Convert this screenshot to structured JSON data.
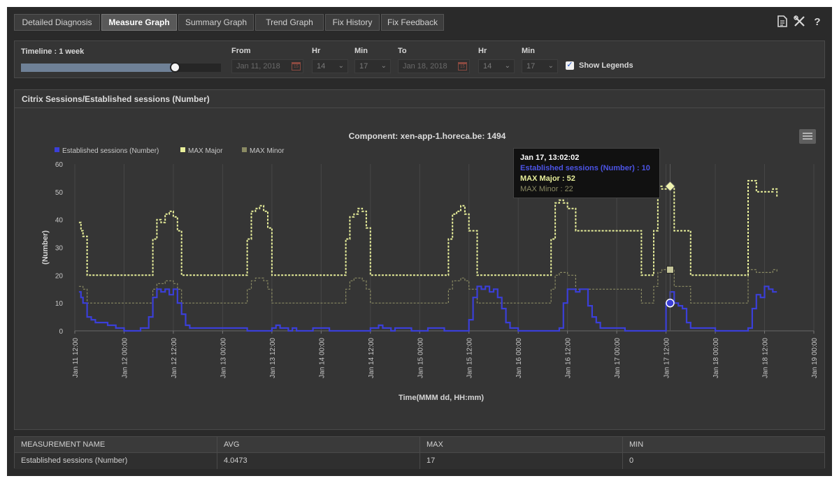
{
  "tabs": [
    {
      "label": "Detailed Diagnosis",
      "active": false
    },
    {
      "label": "Measure Graph",
      "active": true
    },
    {
      "label": "Summary Graph",
      "active": false
    },
    {
      "label": "Trend Graph",
      "active": false
    },
    {
      "label": "Fix History",
      "active": false
    },
    {
      "label": "Fix Feedback",
      "active": false
    }
  ],
  "toolbar_icons": [
    "document-icon",
    "tools-icon",
    "help-icon"
  ],
  "timeline": {
    "label": "Timeline : 1 week",
    "slider_value_fraction": 0.77,
    "from_label": "From",
    "from_date": "Jan 11, 2018",
    "from_hr_label": "Hr",
    "from_hr": "14",
    "from_min_label": "Min",
    "from_min": "17",
    "to_label": "To",
    "to_date": "Jan 18, 2018",
    "to_hr_label": "Hr",
    "to_hr": "14",
    "to_min_label": "Min",
    "to_min": "17",
    "show_legends_label": "Show Legends",
    "show_legends_checked": true
  },
  "panel_title": "Citrix Sessions/Established sessions (Number)",
  "colors": {
    "sessions": "#3b3fd8",
    "max_major": "#e8ef9a",
    "max_minor": "#8a8a63",
    "background": "#353535"
  },
  "tooltip": {
    "title": "Jan 17, 13:02:02",
    "line1": "Established sessions (Number) : 10",
    "line2": "MAX Major : 52",
    "line3": "MAX Minor : 22"
  },
  "chart_data": {
    "type": "line",
    "title": "Component: xen-app-1.horeca.be: 1494",
    "xlabel": "Time(MMM dd, HH:mm)",
    "ylabel": "(Number)",
    "ylim": [
      0,
      60
    ],
    "yticks": [
      "0",
      "10",
      "20",
      "30",
      "40",
      "50",
      "60"
    ],
    "xticks": [
      "Jan 11 12:00",
      "Jan 12 00:00",
      "Jan 12 12:00",
      "Jan 13 00:00",
      "Jan 13 12:00",
      "Jan 14 00:00",
      "Jan 14 12:00",
      "Jan 15 00:00",
      "Jan 15 12:00",
      "Jan 16 00:00",
      "Jan 16 12:00",
      "Jan 17 00:00",
      "Jan 17 12:00",
      "Jan 18 00:00",
      "Jan 18 12:00",
      "Jan 19 00:00"
    ],
    "x_hours_from_jan11_12": [
      0,
      12,
      24,
      36,
      48,
      60,
      72,
      84,
      96,
      108,
      120,
      132,
      144,
      156,
      168,
      180
    ],
    "legend": [
      "Established sessions (Number)",
      "MAX Major",
      "MAX Minor"
    ],
    "legend_position": "top-left",
    "grid": true,
    "series": [
      {
        "name": "Established sessions (Number)",
        "t_hours": [
          1,
          1.5,
          2,
          3,
          4,
          5,
          6,
          8,
          10,
          12,
          14,
          16,
          18,
          19,
          20,
          21,
          22,
          23,
          24,
          25,
          26,
          27,
          28,
          30,
          34,
          38,
          42,
          46,
          48,
          49,
          50,
          51,
          52,
          53,
          54,
          58,
          62,
          66,
          70,
          72,
          73,
          74,
          75,
          76,
          77,
          78,
          82,
          86,
          90,
          94,
          96,
          97,
          98,
          99,
          100,
          101,
          102,
          103,
          104,
          105,
          106,
          108,
          112,
          116,
          118,
          119,
          120,
          121,
          122,
          123,
          124,
          125,
          126,
          127,
          128,
          130,
          134,
          138,
          142,
          144,
          145,
          146,
          147,
          148,
          149,
          150,
          152,
          156,
          160,
          164,
          165,
          166,
          167,
          168,
          169,
          170,
          171
        ],
        "values": [
          14,
          12,
          10,
          5,
          4,
          3,
          3,
          2,
          1,
          0,
          0,
          1,
          5,
          12,
          15,
          14,
          15,
          13,
          15,
          10,
          6,
          2,
          1,
          1,
          1,
          1,
          0,
          0,
          1,
          2,
          1,
          1,
          0,
          1,
          0,
          1,
          0,
          0,
          0,
          1,
          1,
          2,
          1,
          1,
          0,
          1,
          0,
          1,
          0,
          0,
          4,
          12,
          16,
          15,
          16,
          14,
          15,
          12,
          8,
          3,
          1,
          0,
          0,
          0,
          1,
          10,
          15,
          15,
          14,
          15,
          15,
          9,
          5,
          3,
          1,
          1,
          0,
          0,
          0,
          10,
          14,
          10,
          9,
          8,
          3,
          1,
          1,
          0,
          0,
          1,
          8,
          13,
          12,
          16,
          15,
          14,
          14
        ]
      },
      {
        "name": "MAX Major",
        "t_hours": [
          1,
          1.5,
          2,
          3,
          10,
          18,
          19,
          20,
          21,
          22,
          23,
          24,
          25,
          26,
          28,
          40,
          42,
          43,
          44,
          45,
          46,
          47,
          48,
          50,
          64,
          66,
          67,
          68,
          69,
          70,
          71,
          72,
          74,
          90,
          91,
          92,
          93,
          94,
          95,
          96,
          98,
          114,
          115,
          116,
          117,
          118,
          119,
          120,
          122,
          138,
          139,
          140,
          141,
          142,
          143,
          144,
          146,
          150,
          162,
          163,
          164,
          166,
          168,
          170,
          171
        ],
        "values": [
          39,
          36,
          34,
          20,
          20,
          20,
          33,
          40,
          39,
          42,
          43,
          41,
          36,
          20,
          20,
          20,
          33,
          43,
          44,
          45,
          43,
          37,
          20,
          20,
          20,
          33,
          41,
          42,
          44,
          43,
          37,
          20,
          20,
          20,
          33,
          42,
          43,
          45,
          42,
          36,
          20,
          20,
          20,
          33,
          46,
          47,
          46,
          44,
          36,
          20,
          20,
          20,
          36,
          52,
          51,
          52,
          36,
          20,
          20,
          20,
          54,
          50,
          50,
          51,
          48
        ]
      },
      {
        "name": "MAX Minor",
        "t_hours": [
          1,
          2,
          3,
          10,
          18,
          19,
          20,
          22,
          23,
          24,
          25,
          26,
          28,
          40,
          42,
          43,
          44,
          45,
          46,
          47,
          48,
          50,
          64,
          66,
          67,
          68,
          69,
          70,
          71,
          72,
          74,
          90,
          91,
          92,
          93,
          94,
          95,
          96,
          98,
          114,
          115,
          116,
          117,
          118,
          119,
          120,
          122,
          138,
          139,
          140,
          141,
          142,
          143,
          144,
          146,
          150,
          162,
          163,
          164,
          166,
          168,
          170,
          171
        ],
        "values": [
          16,
          15,
          10,
          10,
          10,
          15,
          17,
          18,
          18,
          17,
          15,
          10,
          10,
          10,
          15,
          18,
          19,
          19,
          18,
          15,
          10,
          10,
          10,
          15,
          18,
          19,
          19,
          18,
          15,
          10,
          10,
          10,
          15,
          18,
          18,
          19,
          18,
          15,
          10,
          10,
          10,
          15,
          20,
          21,
          21,
          20,
          15,
          10,
          10,
          10,
          16,
          21,
          22,
          22,
          16,
          10,
          10,
          10,
          22,
          21,
          21,
          22,
          21
        ]
      }
    ],
    "hover_hour": 145
  },
  "table": {
    "headers": [
      "MEASUREMENT NAME",
      "AVG",
      "MAX",
      "MIN"
    ],
    "rows": [
      [
        "Established sessions (Number)",
        "4.0473",
        "17",
        "0"
      ]
    ]
  }
}
